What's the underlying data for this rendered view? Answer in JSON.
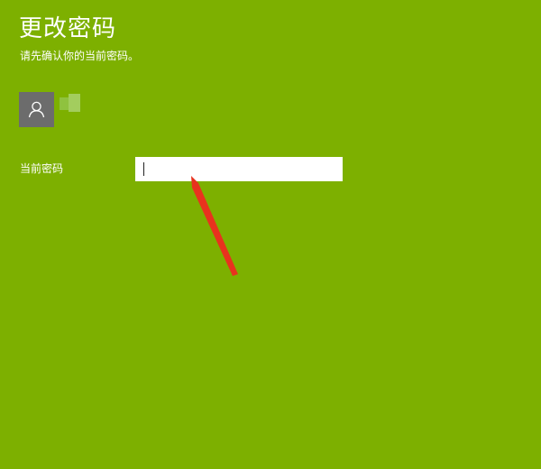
{
  "theme": {
    "background": "#7db000",
    "text": "#ffffff",
    "input_bg": "#ffffff",
    "arrow": "#e8321e"
  },
  "header": {
    "title": "更改密码",
    "subtitle": "请先确认你的当前密码。"
  },
  "account": {
    "avatar_icon": "user-icon"
  },
  "form": {
    "current_password_label": "当前密码",
    "current_password_value": ""
  },
  "annotation": {
    "icon": "red-arrow-pointer"
  }
}
